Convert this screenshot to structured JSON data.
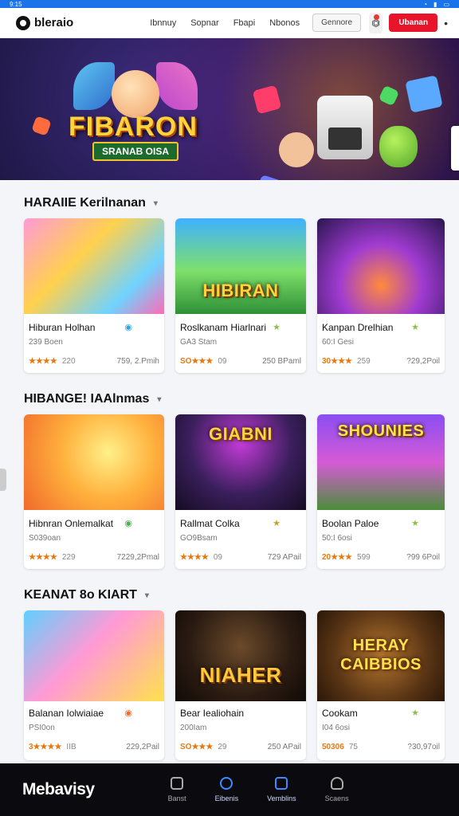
{
  "statusbar": {
    "time": "9:15"
  },
  "topbar": {
    "logo": "bleraio",
    "nav": [
      "Ibnnuy",
      "Sopnar",
      "Fbapi",
      "Nbonos"
    ],
    "nav_button": "Gennore",
    "cta": "Ubanan",
    "more": "•"
  },
  "hero": {
    "title": "FIBARON",
    "subtitle": "SRANAB OISA"
  },
  "sections": [
    {
      "title": "HARAIIE Kerilnanan",
      "cards": [
        {
          "title": "Hiburan Holhan",
          "meta": "239 Boen",
          "rating": "★★★★",
          "rating_num": "220",
          "stats": "759, 2.Pmih",
          "badge": "◉"
        },
        {
          "title": "Roslkanam Hiarlnari",
          "meta": "GA3 Stam",
          "rating": "SO★★★",
          "rating_num": "09",
          "stats": "250 BPaml",
          "badge": "★",
          "thumb_text": "HIBIRAN"
        },
        {
          "title": "Kanpan Drelhian",
          "meta": "60:I Gesi",
          "rating": "30★★★",
          "rating_num": "259",
          "stats": "?29,2Poil",
          "badge": "★"
        }
      ]
    },
    {
      "title": "HIBANGE! IAAlnmas",
      "cards": [
        {
          "title": "Hibnran Onlemalkat",
          "meta": "S039oan",
          "rating": "★★★★",
          "rating_num": "229",
          "stats": "7229,2Pmal",
          "badge": "◉"
        },
        {
          "title": "Rallmat Colka",
          "meta": "GO9Bsam",
          "rating": "★★★★",
          "rating_num": "09",
          "stats": "729 APail",
          "badge": "★",
          "thumb_text": "GIABNI"
        },
        {
          "title": "Boolan Paloe",
          "meta": "50:I 6osi",
          "rating": "20★★★",
          "rating_num": "599",
          "stats": "?99 6Poil",
          "badge": "★",
          "thumb_text": "SHOUNIES"
        }
      ]
    },
    {
      "title": "KEANAT 8o KIART",
      "cards": [
        {
          "title": "Balanan Iolwiaiae",
          "meta": "PSI0on",
          "rating": "3★★★★",
          "rating_num": "IIB",
          "stats": "229,2Pail",
          "badge": "◉"
        },
        {
          "title": "Bear Iealiohain",
          "meta": "200Iam",
          "rating": "SO★★★",
          "rating_num": "29",
          "stats": "250 APail",
          "badge": "",
          "thumb_text": "NIAHER"
        },
        {
          "title": "Cookam",
          "meta": "I04 6osi",
          "rating": "50306",
          "rating_num": "75",
          "stats": "?30,97oil",
          "badge": "★",
          "thumb_text": "HERAY CAIBBIOS"
        }
      ]
    }
  ],
  "bottombar": {
    "brand": "Mebavisy",
    "tabs": [
      "Banst",
      "Eibenis",
      "Vemblins",
      "Scaens"
    ]
  },
  "colors": {
    "accent": "#1a73e8",
    "cta": "#e8142a",
    "rating": "#e8780c",
    "dark": "#0b0b0f"
  }
}
